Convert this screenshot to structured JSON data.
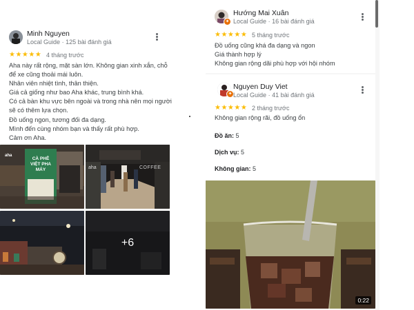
{
  "colors": {
    "star": "#fbbc04",
    "badge": "#e8710a",
    "meta": "#70757a"
  },
  "reviews": [
    {
      "author": "Minh Nguyen",
      "badge": "Local Guide",
      "count": "125 bài đánh giá",
      "stars": "★★★★★",
      "rating": 5,
      "time": "4 tháng trước",
      "lines": [
        "Aha này rất rộng, mặt sàn lớn. Không gian xinh xắn, chỗ",
        "để xe cũng thoải mái luôn.",
        "Nhân viên nhiệt tình, thân thiện.",
        "Giá cả giống như bao Aha khác, trung bình khá.",
        "Có cả bàn khu vực bên ngoài và trong nhà nên mọi người",
        "sẽ có thêm lựa chọn.",
        "Đồ uống ngon, tương đối đa dạng.",
        "Mình đến cùng nhóm bạn và thấy rất phù hợp.",
        "Cảm ơn Aha."
      ],
      "photos": {
        "storefront_sign": "CÀ PHÊ VIỆT PHA MÁY",
        "brand": "aha",
        "entrance_sign": "COFFEE",
        "more": "+6"
      }
    },
    {
      "author": "Hướng Mai Xuân",
      "badge": "Local Guide",
      "count": "16 bài đánh giá",
      "stars": "★★★★★",
      "rating": 5,
      "time": "5 tháng trước",
      "lines": [
        "Đồ uống cũng khá đa dạng và ngon",
        "Giá thành hợp lý",
        "Không gian rộng dãi phù hợp với hội nhóm"
      ]
    },
    {
      "author": "Nguyen Duy Viet",
      "badge": "Local Guide",
      "count": "41 bài đánh giá",
      "stars": "★★★★★",
      "rating": 5,
      "time": "2 tháng trước",
      "lines": [
        "Không gian rộng rãi, đồ uống ổn"
      ],
      "attributes": [
        {
          "label": "Đồ ăn:",
          "value": "5"
        },
        {
          "label": "Dịch vụ:",
          "value": "5"
        },
        {
          "label": "Không gian:",
          "value": "5"
        }
      ],
      "video_duration": "0:22"
    }
  ],
  "separator": "·"
}
